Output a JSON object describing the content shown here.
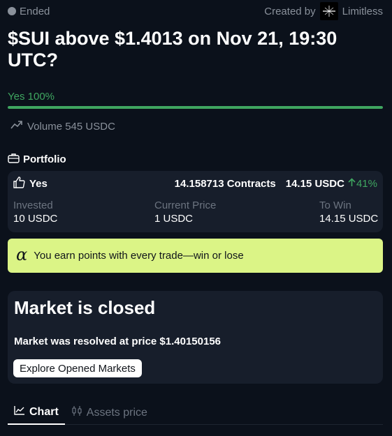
{
  "header": {
    "status": "Ended",
    "created_by_label": "Created by",
    "creator_name": "Limitless"
  },
  "market": {
    "title": "$SUI above $1.4013 on Nov 21, 19:30 UTC?",
    "yes_label": "Yes 100%",
    "yes_fraction": 1.0,
    "volume_text": "Volume 545 USDC"
  },
  "portfolio": {
    "heading": "Portfolio",
    "position": {
      "side": "Yes",
      "contracts": "14.158713 Contracts",
      "value": "14.15 USDC",
      "change": "41%",
      "invested_label": "Invested",
      "invested_value": "10 USDC",
      "current_price_label": "Current Price",
      "current_price_value": "1 USDC",
      "to_win_label": "To Win",
      "to_win_value": "14.15 USDC"
    }
  },
  "points_banner": {
    "icon": "alpha-icon",
    "text": "You earn points with every trade—win or lose"
  },
  "closed": {
    "title": "Market is closed",
    "text": "Market was resolved at price $1.40150156",
    "button": "Explore Opened Markets"
  },
  "tabs": [
    {
      "label": "Chart",
      "icon": "chart-line-icon",
      "active": true
    },
    {
      "label": "Assets price",
      "icon": "candles-icon",
      "active": false
    }
  ],
  "colors": {
    "background": "#0b111b",
    "card": "#171e2b",
    "accent_green": "#3fa660",
    "banner": "#dbf486",
    "muted_text": "#8a919b"
  }
}
